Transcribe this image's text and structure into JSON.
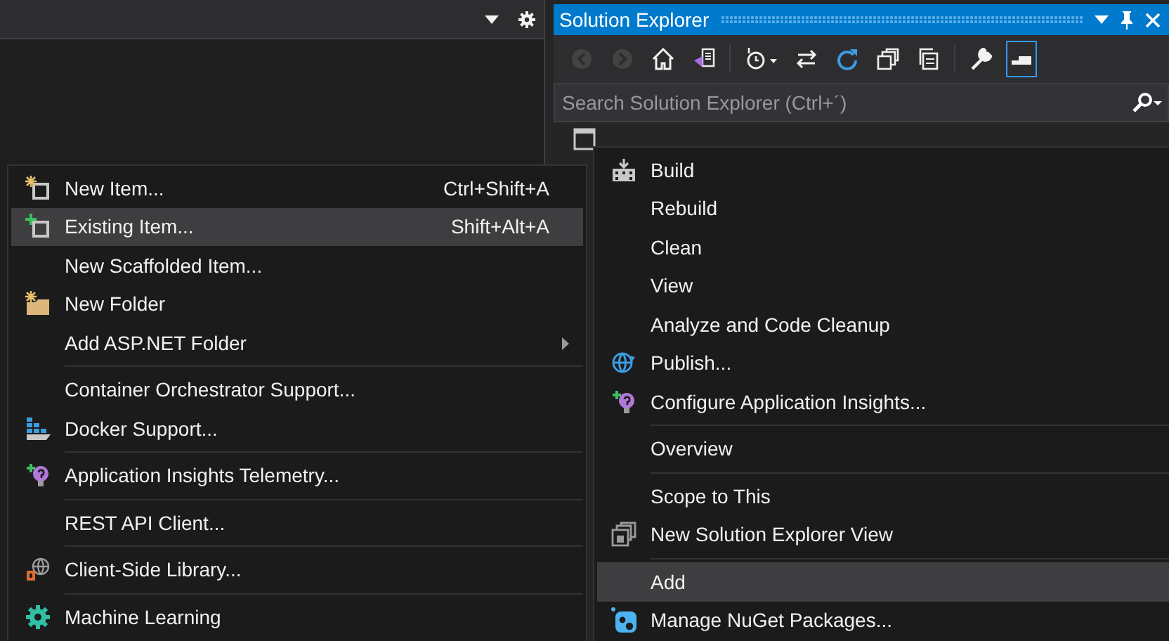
{
  "solution_explorer": {
    "title": "Solution Explorer",
    "toolbar": [
      {
        "disabled": true,
        "selected": false
      },
      {
        "disabled": true,
        "selected": false
      },
      {
        "disabled": false,
        "selected": false
      },
      {
        "disabled": false,
        "selected": false
      },
      {
        "disabled": false,
        "selected": false
      },
      {
        "disabled": false,
        "selected": false
      },
      {
        "disabled": false,
        "selected": false
      },
      {
        "disabled": false,
        "selected": false
      },
      {
        "disabled": false,
        "selected": false
      },
      {
        "disabled": false,
        "selected": false
      },
      {
        "disabled": false,
        "selected": true
      }
    ],
    "search": {
      "placeholder": "Search Solution Explorer (Ctrl+´)"
    }
  },
  "context_menu": {
    "items": [
      {
        "kind": "item",
        "label": "Build",
        "selected": false
      },
      {
        "kind": "item",
        "label": "Rebuild",
        "selected": false
      },
      {
        "kind": "item",
        "label": "Clean",
        "selected": false
      },
      {
        "kind": "item",
        "label": "View",
        "selected": false
      },
      {
        "kind": "item",
        "label": "Analyze and Code Cleanup",
        "selected": false
      },
      {
        "kind": "item",
        "label": "Publish...",
        "selected": false
      },
      {
        "kind": "item",
        "label": "Configure Application Insights...",
        "selected": false
      },
      {
        "kind": "separator"
      },
      {
        "kind": "item",
        "label": "Overview",
        "selected": false
      },
      {
        "kind": "separator"
      },
      {
        "kind": "item",
        "label": "Scope to This",
        "selected": false
      },
      {
        "kind": "item",
        "label": "New Solution Explorer View",
        "selected": false
      },
      {
        "kind": "separator"
      },
      {
        "kind": "item",
        "label": "Add",
        "selected": true
      },
      {
        "kind": "item",
        "label": "Manage NuGet Packages...",
        "selected": false
      }
    ]
  },
  "add_submenu": {
    "items": [
      {
        "kind": "item",
        "label": "New Item...",
        "shortcut": "Ctrl+Shift+A",
        "selected": false
      },
      {
        "kind": "item",
        "label": "Existing Item...",
        "shortcut": "Shift+Alt+A",
        "selected": true
      },
      {
        "kind": "item",
        "label": "New Scaffolded Item...",
        "selected": false
      },
      {
        "kind": "item",
        "label": "New Folder",
        "selected": false
      },
      {
        "kind": "item",
        "label": "Add ASP.NET Folder",
        "submenu": true,
        "selected": false
      },
      {
        "kind": "separator"
      },
      {
        "kind": "item",
        "label": "Container Orchestrator Support...",
        "selected": false
      },
      {
        "kind": "item",
        "label": "Docker Support...",
        "selected": false
      },
      {
        "kind": "separator"
      },
      {
        "kind": "item",
        "label": "Application Insights Telemetry...",
        "selected": false
      },
      {
        "kind": "separator"
      },
      {
        "kind": "item",
        "label": "REST API Client...",
        "selected": false
      },
      {
        "kind": "separator"
      },
      {
        "kind": "item",
        "label": "Client-Side Library...",
        "selected": false
      },
      {
        "kind": "separator"
      },
      {
        "kind": "item",
        "label": "Machine Learning",
        "selected": false
      }
    ]
  }
}
